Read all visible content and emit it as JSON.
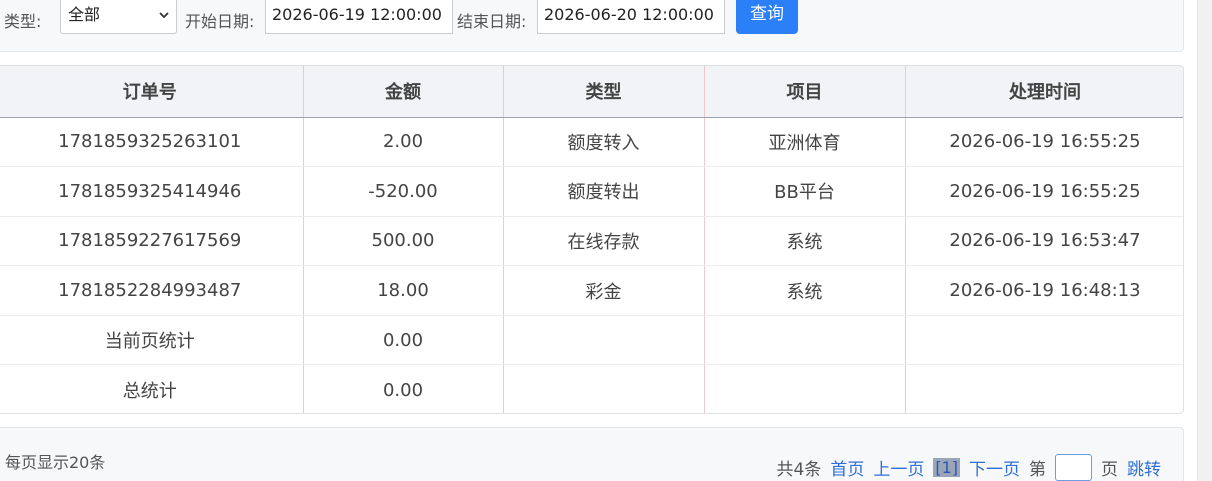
{
  "filters": {
    "type_label": "类型:",
    "type_value": "全部",
    "start_label": "开始日期:",
    "start_value": "2026-06-19 12:00:00",
    "end_label": "结束日期:",
    "end_value": "2026-06-20 12:00:00",
    "query_label": "查询"
  },
  "table": {
    "headers": [
      "订单号",
      "金额",
      "类型",
      "项目",
      "处理时间"
    ],
    "rows": [
      [
        "1781859325263101",
        "2.00",
        "额度转入",
        "亚洲体育",
        "2026-06-19 16:55:25"
      ],
      [
        "1781859325414946",
        "-520.00",
        "额度转出",
        "BB平台",
        "2026-06-19 16:55:25"
      ],
      [
        "1781859227617569",
        "500.00",
        "在线存款",
        "系统",
        "2026-06-19 16:53:47"
      ],
      [
        "1781852284993487",
        "18.00",
        "彩金",
        "系统",
        "2026-06-19 16:48:13"
      ],
      [
        "当前页统计",
        "0.00",
        "",
        "",
        ""
      ],
      [
        "总统计",
        "0.00",
        "",
        "",
        ""
      ]
    ]
  },
  "footer": {
    "per_page": "每页显示20条",
    "total": "共4条",
    "first": "首页",
    "prev": "上一页",
    "current": "[1]",
    "next": "下一页",
    "page_prefix": "第",
    "page_suffix": "页",
    "jump": "跳转"
  },
  "colors": {
    "primary": "#2b7ff7",
    "link": "#2f6fd6"
  },
  "icons": {
    "select_arrow": "chevron-down-icon"
  }
}
